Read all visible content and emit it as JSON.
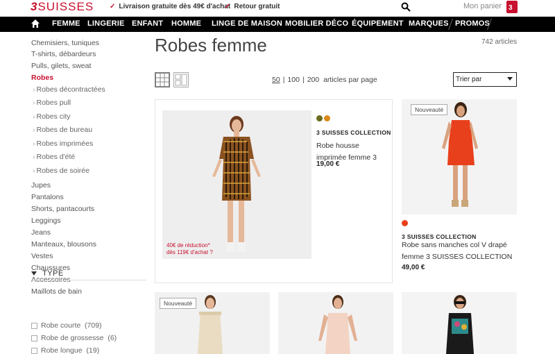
{
  "header": {
    "logo": "SUISSES",
    "logo_prefix": "3",
    "promise_1": "Livraison gratuite dès 49€ d'achat",
    "promise_2": "Retour gratuit",
    "cart_label": "Mon panier"
  },
  "nav": {
    "items": [
      "FEMME",
      "LINGERIE",
      "ENFANT",
      "HOMME",
      "LINGE DE MAISON",
      "MOBILIER DÉCO",
      "ÉQUIPEMENT",
      "MARQUES",
      "PROMOS"
    ]
  },
  "sidebar": {
    "links": [
      "Chemisiers, tuniques",
      "T-shirts, débardeurs",
      "Pulls, gilets, sweat",
      "Robes"
    ],
    "sub_links": [
      "Robes décontractées",
      "Robes pull",
      "Robes city",
      "Robes de bureau",
      "Robes imprimées",
      "Robes d'été",
      "Robes de soirée"
    ],
    "more_links": [
      "Jupes",
      "Pantalons",
      "Shorts, pantacourts",
      "Leggings",
      "Jeans",
      "Manteaux, blousons",
      "Vestes",
      "Chaussures",
      "Accessoires",
      "Maillots de bain"
    ],
    "type_heading": "TYPE",
    "filters": [
      {
        "label": "Robe courte",
        "count": "(709)"
      },
      {
        "label": "Robe de grossesse",
        "count": "(6)"
      },
      {
        "label": "Robe longue",
        "count": "(19)"
      }
    ]
  },
  "main": {
    "title": "Robes femme",
    "count": "742 articles",
    "pager": {
      "options": [
        "50",
        "100",
        "200"
      ],
      "suffix": "articles par page"
    },
    "sort_label": "Trier par"
  },
  "products": [
    {
      "brand": "3 SUISSES COLLECTION",
      "name": "Robe housse imprimée femme 3",
      "price": "19,00 €",
      "promo_line1": "40€ de réduction*",
      "promo_line2": "dès 119€ d'achat",
      "promo_q": "?",
      "swatches": [
        "#6b6b1e",
        "#d98a1a"
      ]
    },
    {
      "badge": "Nouveauté",
      "brand": "3 SUISSES COLLECTION",
      "name": "Robe sans manches col V drapé femme 3 SUISSES COLLECTION",
      "price": "49,00 €",
      "swatches": [
        "#e8401c"
      ]
    },
    {
      "badge": "Nouveauté"
    }
  ],
  "colors": {
    "brand_red": "#c8102e",
    "nav_bg": "#000000"
  }
}
